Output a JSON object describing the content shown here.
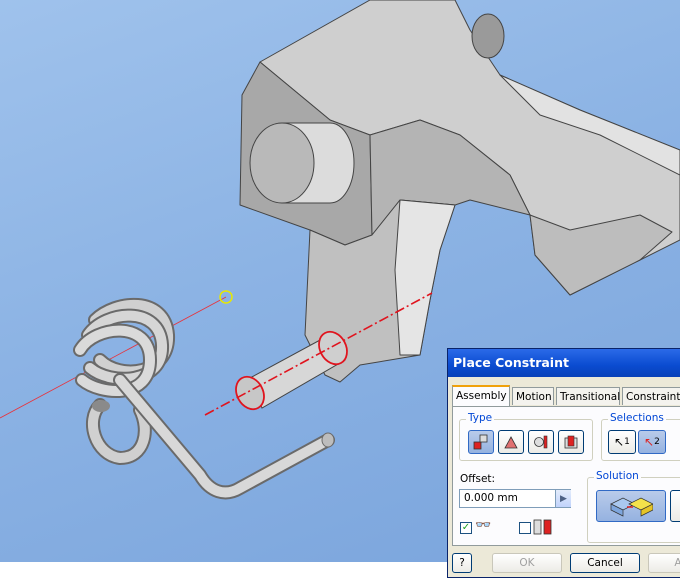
{
  "dialog": {
    "title": "Place Constraint",
    "tabs": [
      "Assembly",
      "Motion",
      "Transitional",
      "Constraint S"
    ],
    "active_tab": "Assembly",
    "type_label": "Type",
    "type_icons": [
      "mate-constraint-icon",
      "angle-constraint-icon",
      "tangent-constraint-icon",
      "insert-constraint-icon"
    ],
    "selections_label": "Selections",
    "selection_1": "1",
    "selection_2": "2",
    "offset_label": "Offset:",
    "offset_value": "0.000 mm",
    "solution_label": "Solution",
    "preview_checked": true,
    "predict_offset_checked": false,
    "buttons": {
      "help": "?",
      "ok": "OK",
      "cancel": "Cancel",
      "apply": "A"
    }
  },
  "colors": {
    "viewport_bg": "#8cb3e4",
    "part_gray": "#c6c6c6",
    "selection_red": "#e0141e",
    "titlebar_blue": "#0a4bd0"
  }
}
